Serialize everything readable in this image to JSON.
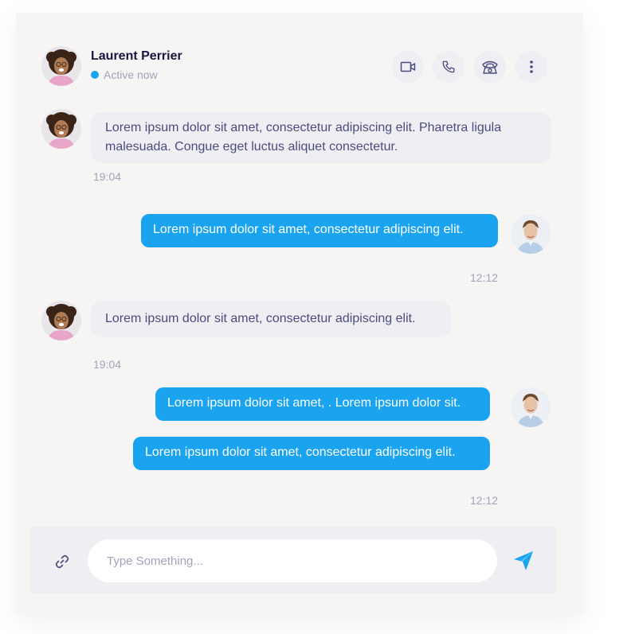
{
  "contact": {
    "name": "Laurent Perrier",
    "status": "Active now"
  },
  "header_actions": [
    {
      "icon": "video-icon"
    },
    {
      "icon": "phone-icon"
    },
    {
      "icon": "telephone-icon"
    },
    {
      "icon": "more-vertical-icon"
    }
  ],
  "messages": [
    {
      "direction": "incoming",
      "text": "Lorem ipsum dolor sit amet, consectetur adipiscing elit. Pharetra ligula malesuada. Congue eget luctus aliquet consectetur.",
      "time": "19:04"
    },
    {
      "direction": "outgoing",
      "text": "Lorem ipsum dolor sit amet, consectetur adipiscing elit.",
      "time": "12:12"
    },
    {
      "direction": "incoming",
      "text": "Lorem ipsum dolor sit amet, consectetur adipiscing elit.",
      "time": "19:04"
    },
    {
      "direction": "outgoing",
      "text": "Lorem ipsum dolor sit amet, . Lorem ipsum dolor sit."
    },
    {
      "direction": "outgoing",
      "text": "Lorem ipsum dolor sit amet, consectetur adipiscing elit.",
      "time": "12:12"
    }
  ],
  "composer": {
    "placeholder": "Type Something...",
    "attach_icon": "link-icon",
    "send_icon": "send-icon"
  },
  "colors": {
    "accent": "#1aa3ee",
    "panel": "#f6f5f4",
    "incoming_bubble": "#efeff3",
    "incoming_text": "#4b4b80",
    "muted": "#a4a2bb"
  }
}
